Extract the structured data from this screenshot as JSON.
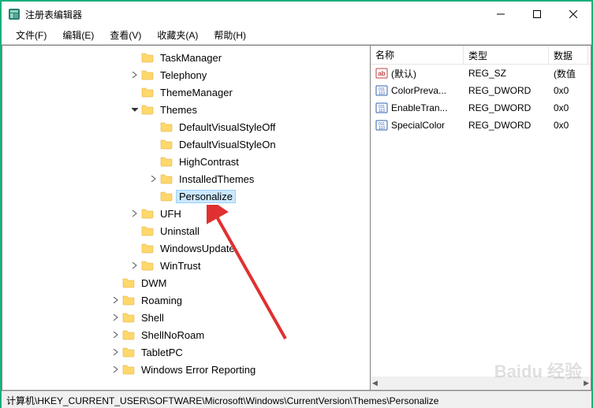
{
  "window": {
    "title": "注册表编辑器"
  },
  "menu": {
    "file": "文件(F)",
    "edit": "编辑(E)",
    "view": "查看(V)",
    "favorites": "收藏夹(A)",
    "help": "帮助(H)"
  },
  "tree": [
    {
      "label": "TaskManager",
      "indent": 160,
      "exp": ""
    },
    {
      "label": "Telephony",
      "indent": 160,
      "exp": ">"
    },
    {
      "label": "ThemeManager",
      "indent": 160,
      "exp": ""
    },
    {
      "label": "Themes",
      "indent": 160,
      "exp": "v"
    },
    {
      "label": "DefaultVisualStyleOff",
      "indent": 184,
      "exp": ""
    },
    {
      "label": "DefaultVisualStyleOn",
      "indent": 184,
      "exp": ""
    },
    {
      "label": "HighContrast",
      "indent": 184,
      "exp": ""
    },
    {
      "label": "InstalledThemes",
      "indent": 184,
      "exp": ">"
    },
    {
      "label": "Personalize",
      "indent": 184,
      "exp": "",
      "selected": true
    },
    {
      "label": "UFH",
      "indent": 160,
      "exp": ">"
    },
    {
      "label": "Uninstall",
      "indent": 160,
      "exp": ""
    },
    {
      "label": "WindowsUpdate",
      "indent": 160,
      "exp": ""
    },
    {
      "label": "WinTrust",
      "indent": 160,
      "exp": ">"
    },
    {
      "label": "DWM",
      "indent": 136,
      "exp": ""
    },
    {
      "label": "Roaming",
      "indent": 136,
      "exp": ">"
    },
    {
      "label": "Shell",
      "indent": 136,
      "exp": ">"
    },
    {
      "label": "ShellNoRoam",
      "indent": 136,
      "exp": ">"
    },
    {
      "label": "TabletPC",
      "indent": 136,
      "exp": ">"
    },
    {
      "label": "Windows Error Reporting",
      "indent": 136,
      "exp": ">"
    }
  ],
  "list": {
    "headers": {
      "name": "名称",
      "type": "类型",
      "data": "数据"
    },
    "rows": [
      {
        "icon": "sz",
        "name": "(默认)",
        "type": "REG_SZ",
        "data": "(数值"
      },
      {
        "icon": "dw",
        "name": "ColorPreva...",
        "type": "REG_DWORD",
        "data": "0x0"
      },
      {
        "icon": "dw",
        "name": "EnableTran...",
        "type": "REG_DWORD",
        "data": "0x0"
      },
      {
        "icon": "dw",
        "name": "SpecialColor",
        "type": "REG_DWORD",
        "data": "0x0"
      }
    ]
  },
  "statusbar": "计算机\\HKEY_CURRENT_USER\\SOFTWARE\\Microsoft\\Windows\\CurrentVersion\\Themes\\Personalize",
  "watermark": "Baidu 经验"
}
